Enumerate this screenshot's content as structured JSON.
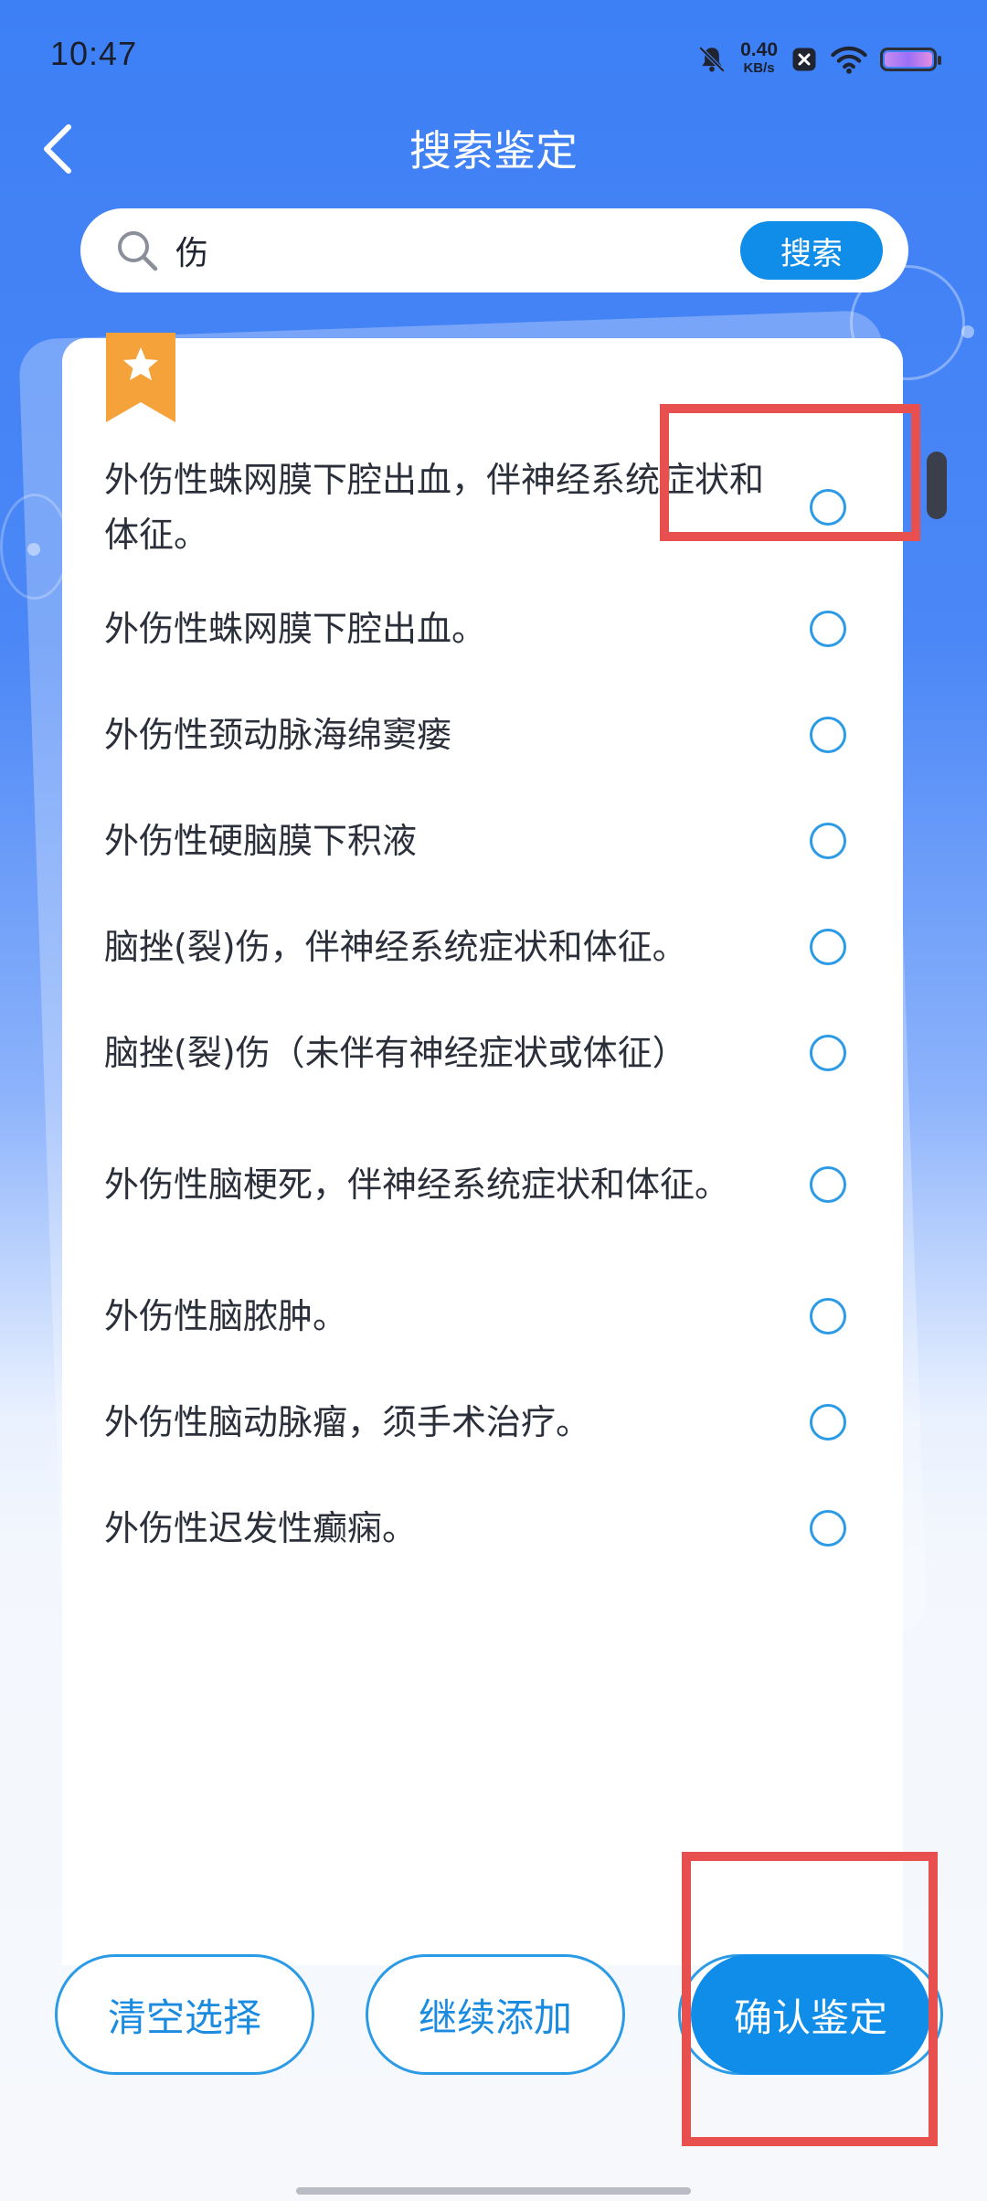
{
  "status_bar": {
    "time": "10:47",
    "net_speed_value": "0.40",
    "net_speed_unit": "KB/s",
    "icons": [
      "muted-bell-icon",
      "app-notification-icon",
      "wifi-icon",
      "battery-icon"
    ]
  },
  "header": {
    "title": "搜索鉴定",
    "back_icon": "chevron-left-icon"
  },
  "search": {
    "query": "伤",
    "button_label": "搜索",
    "icon": "search-icon"
  },
  "results": {
    "badge_icon": "star-bookmark-icon",
    "items": [
      {
        "label": "外伤性蛛网膜下腔出血，伴神经系统症状和体征。",
        "selected": false
      },
      {
        "label": "外伤性蛛网膜下腔出血。",
        "selected": false
      },
      {
        "label": "外伤性颈动脉海绵窦瘘",
        "selected": false
      },
      {
        "label": "外伤性硬脑膜下积液",
        "selected": false
      },
      {
        "label": "脑挫(裂)伤，伴神经系统症状和体征。",
        "selected": false
      },
      {
        "label": "脑挫(裂)伤（未伴有神经症状或体征）",
        "selected": false
      },
      {
        "label": "外伤性脑梗死，伴神经系统症状和体征。",
        "selected": false
      },
      {
        "label": "外伤性脑脓肿。",
        "selected": false
      },
      {
        "label": "外伤性脑动脉瘤，须手术治疗。",
        "selected": false
      },
      {
        "label": "外伤性迟发性癫痫。",
        "selected": false
      }
    ]
  },
  "actions": {
    "clear_label": "清空选择",
    "continue_label": "继续添加",
    "confirm_label": "确认鉴定"
  },
  "colors": {
    "primary": "#0f8de8",
    "header_bg": "#3d7ff5",
    "annotation": "#e8504f",
    "badge": "#f5a23a"
  }
}
